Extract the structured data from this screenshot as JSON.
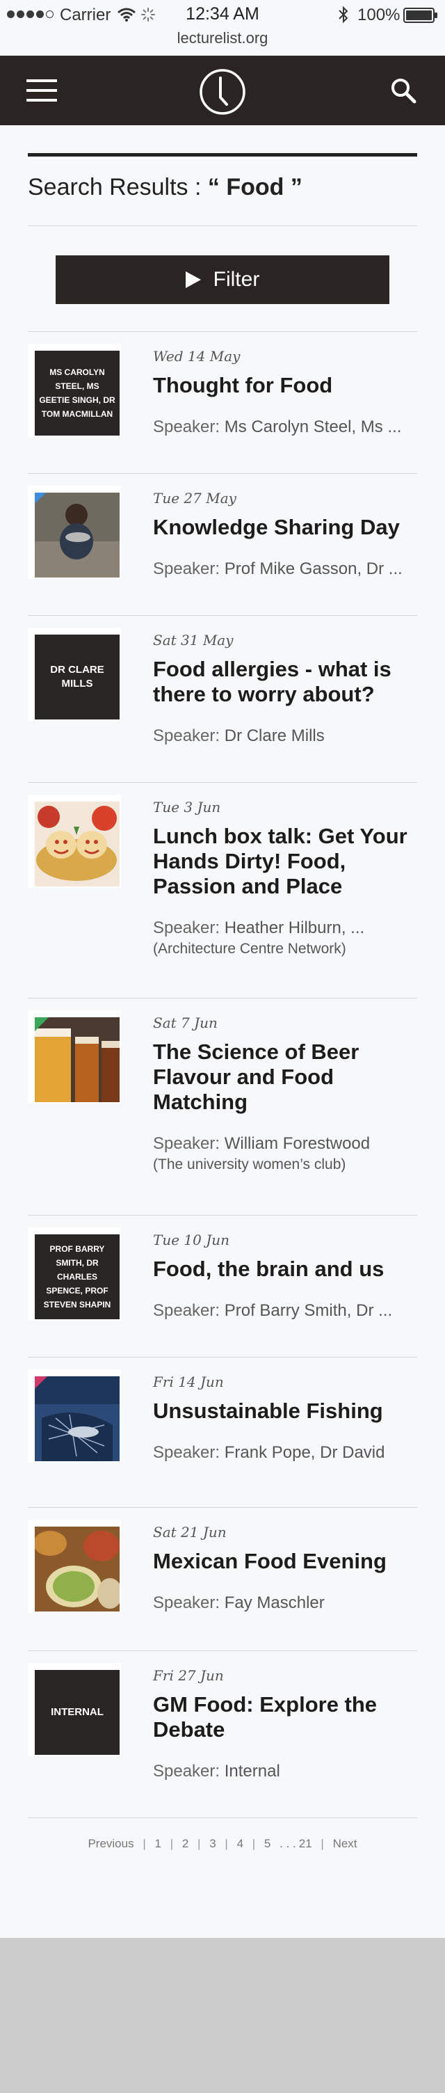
{
  "status_bar": {
    "carrier": "Carrier",
    "time": "12:34 AM",
    "battery": "100%",
    "url": "lecturelist.org"
  },
  "nav": {
    "menu_icon": "hamburger-menu-icon",
    "logo_icon": "lecturelist-logo-icon",
    "search_icon": "search-icon"
  },
  "search": {
    "prefix": "Search Results : ",
    "query": "“ Food ”"
  },
  "filter": {
    "label": "Filter"
  },
  "events": [
    {
      "thumb_text": "MS CAROLYN STEEL, MS GEETIE SINGH, DR TOM MACMILLAN",
      "date": "Wed 14 May",
      "title": "Thought for Food",
      "speaker_label": "Speaker:",
      "speaker": "Ms Carolyn Steel, Ms ...",
      "venue": ""
    },
    {
      "thumb_text": "",
      "date": "Tue 27 May",
      "title": "Knowledge Sharing Day",
      "speaker_label": "Speaker:",
      "speaker": "Prof Mike Gasson, Dr ...",
      "venue": ""
    },
    {
      "thumb_text": "DR CLARE MILLS",
      "date": "Sat 31 May",
      "title": "Food allergies - what is there to worry about?",
      "speaker_label": "Speaker:",
      "speaker": "Dr Clare Mills",
      "venue": ""
    },
    {
      "thumb_text": "",
      "date": "Tue 3 Jun",
      "title": "Lunch box talk: Get Your Hands Dirty!  Food, Passion and Place",
      "speaker_label": "Speaker:",
      "speaker": "Heather Hilburn, ...",
      "venue": "(Architecture Centre Network)"
    },
    {
      "thumb_text": "",
      "date": "Sat 7 Jun",
      "title": "The Science of Beer Flavour and Food Matching",
      "speaker_label": "Speaker:",
      "speaker": "William Forestwood",
      "venue": "(The university women’s club)"
    },
    {
      "thumb_text": "PROF BARRY SMITH, DR CHARLES SPENCE, PROF STEVEN SHAPIN",
      "date": "Tue 10 Jun",
      "title": "Food, the brain and us",
      "speaker_label": "Speaker:",
      "speaker": "Prof Barry Smith, Dr ...",
      "venue": ""
    },
    {
      "thumb_text": "",
      "date": "Fri 14 Jun",
      "title": "Unsustainable Fishing",
      "speaker_label": "Speaker:",
      "speaker": "Frank Pope, Dr David",
      "venue": ""
    },
    {
      "thumb_text": "",
      "date": "Sat 21 Jun",
      "title": "Mexican Food Evening",
      "speaker_label": "Speaker:",
      "speaker": "Fay Maschler",
      "venue": ""
    },
    {
      "thumb_text": "INTERNAL",
      "date": "Fri 27 Jun",
      "title": "GM Food: Explore the Debate",
      "speaker_label": "Speaker:",
      "speaker": "Internal",
      "venue": ""
    }
  ],
  "pagination": {
    "previous": "Previous",
    "pages": [
      "1",
      "2",
      "3",
      "4",
      "5"
    ],
    "ellipsis": ". . .",
    "last": "21",
    "next": "Next",
    "separator": "|"
  },
  "colors": {
    "nav_bg": "#2a2523",
    "page_bg": "#f7f8fa",
    "text": "#1e1b1b",
    "footer": "#cbcbcb"
  }
}
